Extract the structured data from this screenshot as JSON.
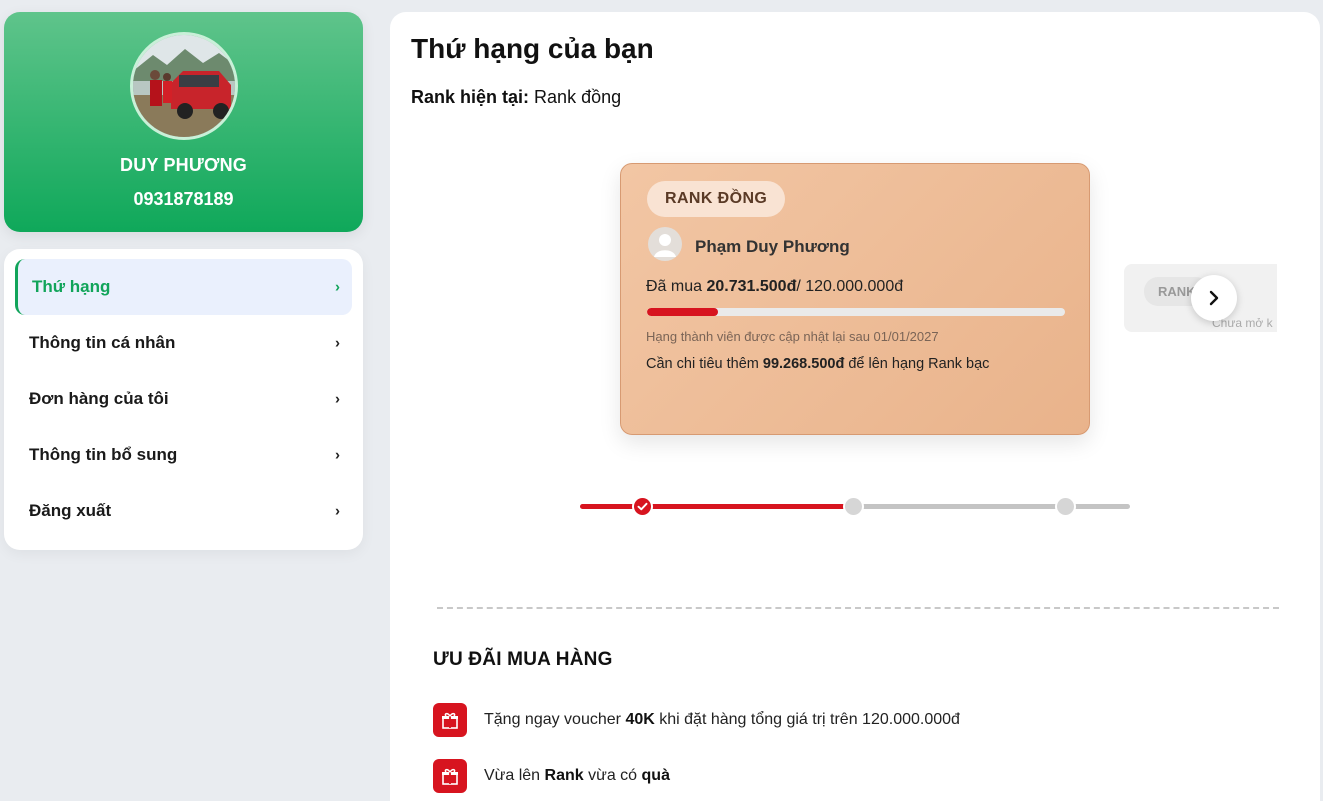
{
  "profile": {
    "name": "DUY PHƯƠNG",
    "phone": "0931878189"
  },
  "menu": {
    "items": [
      {
        "label": "Thứ hạng",
        "chevron": "›",
        "active": true
      },
      {
        "label": "Thông tin cá nhân",
        "chevron": "›"
      },
      {
        "label": "Đơn hàng của tôi",
        "chevron": "›"
      },
      {
        "label": "Thông tin bổ sung",
        "chevron": "›"
      },
      {
        "label": "Đăng xuất",
        "chevron": "›"
      }
    ]
  },
  "main": {
    "title": "Thứ hạng của bạn",
    "current_label": "Rank hiện tại:",
    "current_value": "Rank đồng"
  },
  "rank_card": {
    "badge": "RANK ĐỒNG",
    "member_name": "Phạm Duy Phương",
    "bought_label": "Đã mua",
    "bought_amount": "20.731.500đ",
    "bought_target": "/ 120.000.000đ",
    "progress_fraction": 0.17,
    "update_note": "Hạng thành viên được cập nhật lại sau 01/01/2027",
    "need_prefix": "Cần chi tiêu thêm",
    "need_amount": "99.268.500đ",
    "need_suffix": "để lên hạng Rank bạc"
  },
  "next_card": {
    "badge": "RANK",
    "sub": "Chưa mở k",
    "next_icon": "chevron-right-icon"
  },
  "tier_track": {
    "reached_fraction": 0.49,
    "steps": 3,
    "current_step": 1
  },
  "perks": {
    "title": "ƯU ĐÃI MUA HÀNG",
    "items": [
      {
        "pre": "Tặng ngay voucher",
        "bold1": "40K",
        "post": "khi đặt hàng tổng giá trị trên 120.000.000đ",
        "icon": "gift-icon"
      },
      {
        "pre": "Vừa lên",
        "bold1": "Rank",
        "mid": "vừa có",
        "bold2": "quà",
        "icon": "gift-icon"
      }
    ]
  },
  "colors": {
    "accent_green": "#11a45a",
    "accent_red": "#d7141f",
    "bronze": "#e9b38b"
  }
}
